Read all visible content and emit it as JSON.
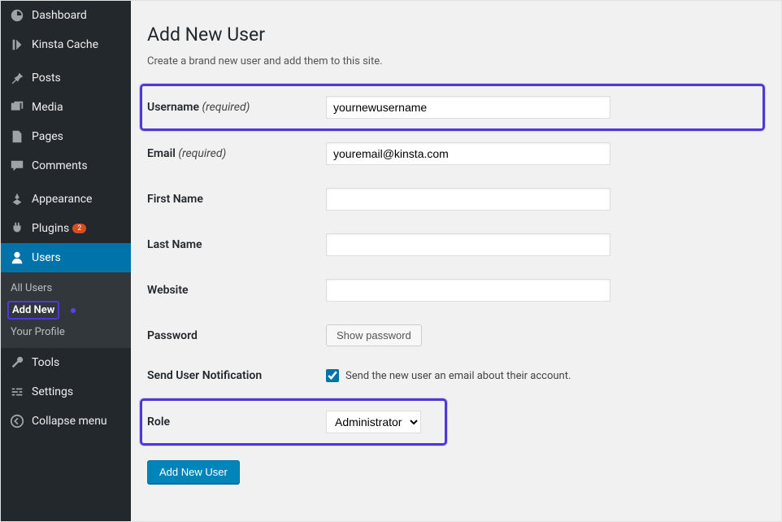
{
  "sidebar": {
    "items": [
      {
        "label": "Dashboard"
      },
      {
        "label": "Kinsta Cache"
      },
      {
        "label": "Posts"
      },
      {
        "label": "Media"
      },
      {
        "label": "Pages"
      },
      {
        "label": "Comments"
      },
      {
        "label": "Appearance"
      },
      {
        "label": "Plugins",
        "badge": "2"
      },
      {
        "label": "Users",
        "active": true
      },
      {
        "label": "Tools"
      },
      {
        "label": "Settings"
      },
      {
        "label": "Collapse menu"
      }
    ],
    "submenu": [
      {
        "label": "All Users"
      },
      {
        "label": "Add New",
        "current": true
      },
      {
        "label": "Your Profile"
      }
    ]
  },
  "page": {
    "title": "Add New User",
    "description": "Create a brand new user and add them to this site.",
    "labels": {
      "username": "Username",
      "required": "(required)",
      "email": "Email",
      "first_name": "First Name",
      "last_name": "Last Name",
      "website": "Website",
      "password": "Password",
      "show_password": "Show password",
      "send_notification": "Send User Notification",
      "notification_text": "Send the new user an email about their account.",
      "role": "Role"
    },
    "values": {
      "username": "yournewusername",
      "email": "youremail@kinsta.com",
      "first_name": "",
      "last_name": "",
      "website": "",
      "role": "Administrator",
      "notify_checked": true
    },
    "submit_label": "Add New User"
  }
}
